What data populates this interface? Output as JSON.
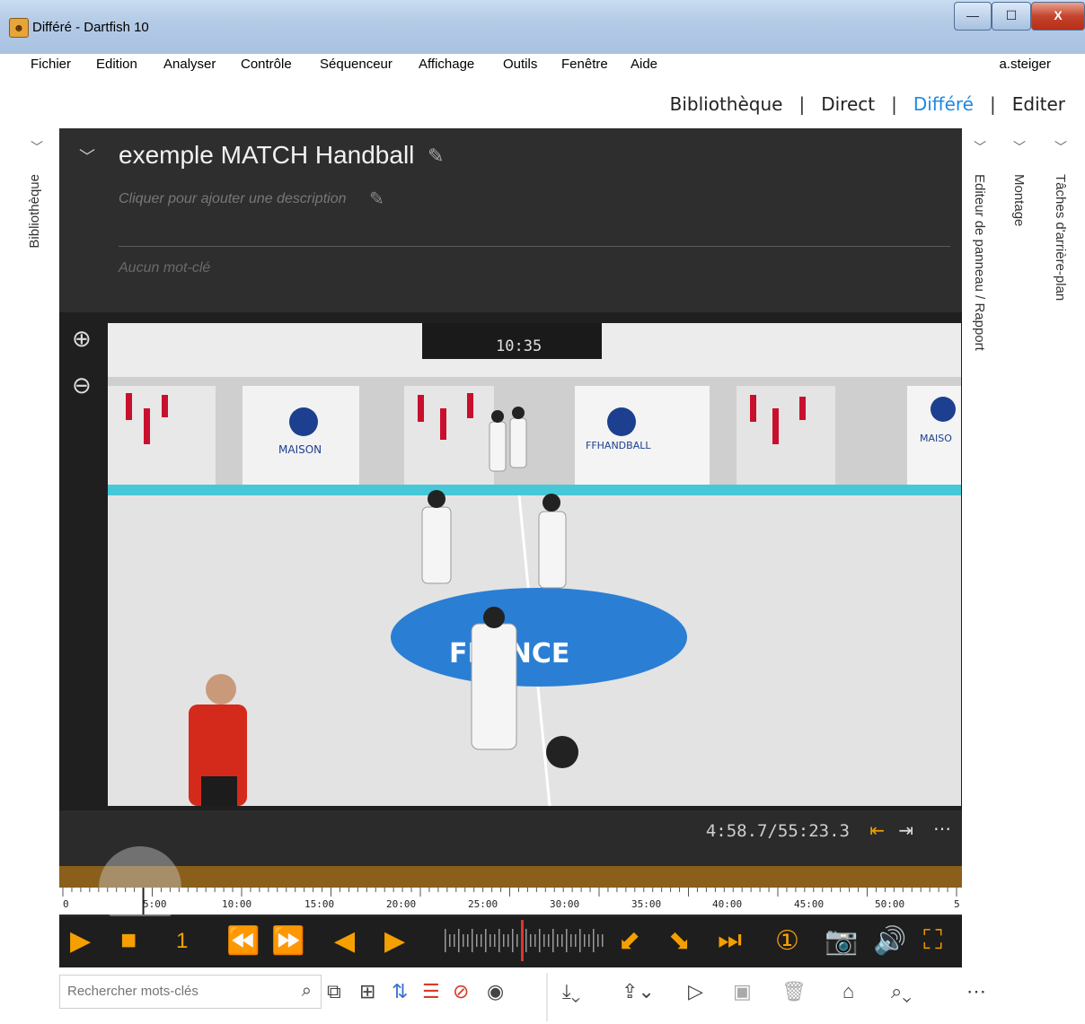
{
  "window": {
    "title": "Différé - Dartfish 10",
    "minimize": "—",
    "maximize": "☐",
    "close": "X"
  },
  "menu": [
    "Fichier",
    "Edition",
    "Analyser",
    "Contrôle",
    "Séquenceur",
    "Affichage",
    "Outils",
    "Fenêtre",
    "Aide"
  ],
  "user": "a.steiger",
  "modes": {
    "tab1": "Bibliothèque",
    "tab2": "Direct",
    "tab3": "Différé",
    "tab4": "Editer",
    "sep": "|"
  },
  "side_left": "Bibliothèque",
  "side_right": [
    "Editeur de panneau / Rapport",
    "Montage",
    "Tâches d'arrière-plan"
  ],
  "clip": {
    "title": "exemple MATCH Handball",
    "description": "Cliquer pour ajouter une description",
    "keywords": "Aucun mot-clé"
  },
  "video": {
    "scoreboard": "10:35",
    "banner_left": "MAISON",
    "banner_mid": "FFHANDBALL",
    "banner_right": "MAISO",
    "court": "FRANCE"
  },
  "transport": {
    "time": "4:58.7/55:23.3",
    "speed": "1"
  },
  "timeline": {
    "ticks": [
      "0",
      "5:00",
      "10:00",
      "15:00",
      "20:00",
      "25:00",
      "30:00",
      "35:00",
      "40:00",
      "45:00",
      "50:00",
      "5"
    ],
    "position": 0.09
  },
  "search": {
    "placeholder": "Rechercher mots-clés"
  },
  "colors": {
    "accent": "#f5a000",
    "active_tab": "#1e88e5",
    "panel": "#2b2b2b"
  }
}
